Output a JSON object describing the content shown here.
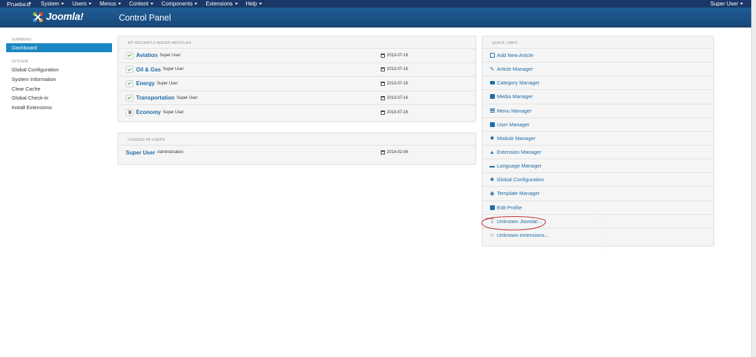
{
  "navbar": {
    "site_name": "Prueba",
    "menu": [
      "System",
      "Users",
      "Menus",
      "Content",
      "Components",
      "Extensions",
      "Help"
    ],
    "user": "Super User"
  },
  "header": {
    "logo_text": "Joomla!",
    "page_title": "Control Panel"
  },
  "sidebar": {
    "submenu_heading": "SUBMENU",
    "active_item": "Dashboard",
    "system_heading": "SYSTEM",
    "items": [
      "Global Configuration",
      "System Information",
      "Clear Cache",
      "Global Check-in",
      "Install Extensions"
    ]
  },
  "recent_articles": {
    "heading": "MY RECENTLY ADDED ARTICLES",
    "rows": [
      {
        "title": "Aviation",
        "author": "Super User",
        "date": "2013-07-16",
        "status": "published"
      },
      {
        "title": "Oil & Gas",
        "author": "Super User",
        "date": "2013-07-16",
        "status": "published"
      },
      {
        "title": "Energy",
        "author": "Super User",
        "date": "2013-07-16",
        "status": "published"
      },
      {
        "title": "Transportation",
        "author": "Super User",
        "date": "2013-07-16",
        "status": "published"
      },
      {
        "title": "Economy",
        "author": "Super User",
        "date": "2013-07-16",
        "status": "trashed"
      }
    ]
  },
  "logged_in_users": {
    "heading": "LOGGED-IN USERS",
    "rows": [
      {
        "name": "Super User",
        "area": "Administration",
        "date": "2014-02-06"
      }
    ]
  },
  "quick_links": {
    "heading": "QUICK LINKS",
    "items": [
      {
        "label": "Add New Article",
        "icon": "file-add-icon"
      },
      {
        "label": "Article Manager",
        "icon": "pencil-icon"
      },
      {
        "label": "Category Manager",
        "icon": "folder-icon"
      },
      {
        "label": "Media Manager",
        "icon": "images-icon"
      },
      {
        "label": "Menu Manager",
        "icon": "list-icon"
      },
      {
        "label": "User Manager",
        "icon": "user-icon"
      },
      {
        "label": "Module Manager",
        "icon": "cube-icon"
      },
      {
        "label": "Extension Manager",
        "icon": "puzzle-icon"
      },
      {
        "label": "Language Manager",
        "icon": "comment-icon"
      },
      {
        "label": "Global Configuration",
        "icon": "cog-icon"
      },
      {
        "label": "Template Manager",
        "icon": "eye-icon"
      },
      {
        "label": "Edit Profile",
        "icon": "vcard-icon"
      },
      {
        "label": "Unknown Joomla!...",
        "icon": "download-icon"
      },
      {
        "label": "Unknown extensions...",
        "icon": "star-icon"
      }
    ]
  },
  "colors": {
    "navbar": "#1a3867",
    "header": "#17487a",
    "accent": "#1a87c3",
    "link": "#1f6ba6",
    "published": "#46a546",
    "annotation": "#c0282a"
  }
}
